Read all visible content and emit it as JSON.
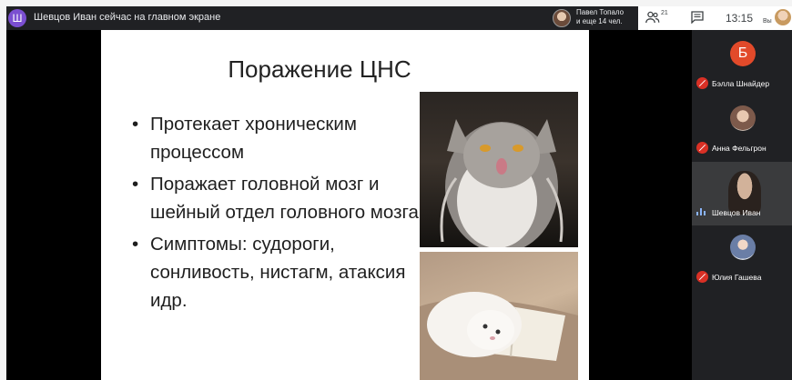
{
  "header": {
    "presenter_initial": "Ш",
    "presenter_status": "Шевцов Иван сейчас на главном экране",
    "people_text_line1": "Павел Топало",
    "people_text_line2": "и еще 14 чел.",
    "people_count": "21",
    "time": "13:15",
    "you_label": "Вы"
  },
  "slide": {
    "title": "Поражение ЦНС",
    "bullets": [
      "Протекает хроническим процессом",
      "Поражает головной мозг и шейный отдел головного мозга",
      "Симптомы: судороги, сонливость, нистагм, атаксия идр."
    ]
  },
  "participants": [
    {
      "name": "Бэлла Шнайдер",
      "initial": "Б",
      "muted": true
    },
    {
      "name": "Анна Фельгрон",
      "muted": true
    },
    {
      "name": "Шевцов Иван",
      "muted": false,
      "speaking": true
    },
    {
      "name": "Юлия Гашева",
      "muted": true
    }
  ],
  "colors": {
    "accent_purple": "#7b4fd1",
    "mute_red": "#d93025",
    "avatar_orange": "#e24a2a",
    "meet_dark": "#202124"
  }
}
